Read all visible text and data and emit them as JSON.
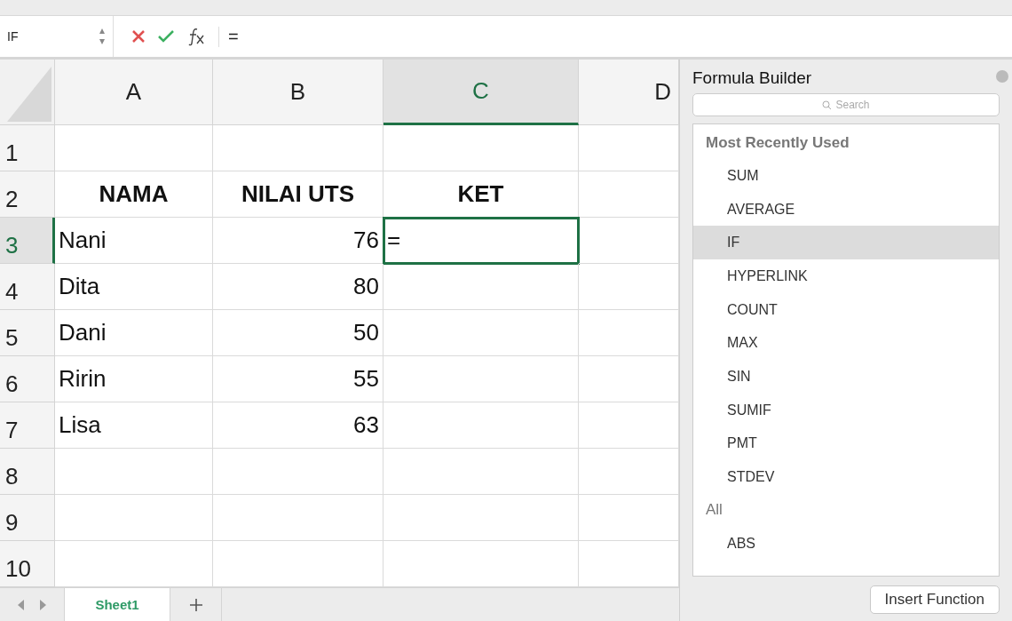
{
  "formula_bar": {
    "name_box": "IF",
    "formula": "="
  },
  "columns": [
    {
      "label": "A",
      "selected": false
    },
    {
      "label": "B",
      "selected": false
    },
    {
      "label": "C",
      "selected": true
    },
    {
      "label": "D",
      "selected": false
    }
  ],
  "rows": [
    {
      "label": "1",
      "selected": false,
      "cells": [
        {
          "text": "",
          "active": false
        },
        {
          "text": "",
          "active": false
        },
        {
          "text": "",
          "active": false
        },
        {
          "text": "",
          "active": false
        }
      ]
    },
    {
      "label": "2",
      "selected": false,
      "cells": [
        {
          "text": "NAMA",
          "active": false
        },
        {
          "text": "NILAI UTS",
          "active": false
        },
        {
          "text": "KET",
          "active": false
        },
        {
          "text": "",
          "active": false
        }
      ]
    },
    {
      "label": "3",
      "selected": true,
      "cells": [
        {
          "text": "Nani",
          "active": false
        },
        {
          "text": "76",
          "active": false
        },
        {
          "text": "=",
          "active": true
        },
        {
          "text": "",
          "active": false
        }
      ]
    },
    {
      "label": "4",
      "selected": false,
      "cells": [
        {
          "text": "Dita",
          "active": false
        },
        {
          "text": "80",
          "active": false
        },
        {
          "text": "",
          "active": false
        },
        {
          "text": "",
          "active": false
        }
      ]
    },
    {
      "label": "5",
      "selected": false,
      "cells": [
        {
          "text": "Dani",
          "active": false
        },
        {
          "text": "50",
          "active": false
        },
        {
          "text": "",
          "active": false
        },
        {
          "text": "",
          "active": false
        }
      ]
    },
    {
      "label": "6",
      "selected": false,
      "cells": [
        {
          "text": "Ririn",
          "active": false
        },
        {
          "text": "55",
          "active": false
        },
        {
          "text": "",
          "active": false
        },
        {
          "text": "",
          "active": false
        }
      ]
    },
    {
      "label": "7",
      "selected": false,
      "cells": [
        {
          "text": "Lisa",
          "active": false
        },
        {
          "text": "63",
          "active": false
        },
        {
          "text": "",
          "active": false
        },
        {
          "text": "",
          "active": false
        }
      ]
    },
    {
      "label": "8",
      "selected": false,
      "cells": [
        {
          "text": "",
          "active": false
        },
        {
          "text": "",
          "active": false
        },
        {
          "text": "",
          "active": false
        },
        {
          "text": "",
          "active": false
        }
      ]
    },
    {
      "label": "9",
      "selected": false,
      "cells": [
        {
          "text": "",
          "active": false
        },
        {
          "text": "",
          "active": false
        },
        {
          "text": "",
          "active": false
        },
        {
          "text": "",
          "active": false
        }
      ]
    },
    {
      "label": "10",
      "selected": false,
      "cells": [
        {
          "text": "",
          "active": false
        },
        {
          "text": "",
          "active": false
        },
        {
          "text": "",
          "active": false
        },
        {
          "text": "",
          "active": false
        }
      ]
    }
  ],
  "sheet_tabs": [
    {
      "label": "Sheet1",
      "selected": true
    }
  ],
  "formula_builder": {
    "title": "Formula Builder",
    "search": {
      "placeholder": "Search"
    },
    "groups": [
      {
        "label": "Most Recently Used",
        "children": [
          {
            "label": "SUM",
            "selected": false
          },
          {
            "label": "AVERAGE",
            "selected": false
          },
          {
            "label": "IF",
            "selected": true
          },
          {
            "label": "HYPERLINK",
            "selected": false
          },
          {
            "label": "COUNT",
            "selected": false
          },
          {
            "label": "MAX",
            "selected": false
          },
          {
            "label": "SIN",
            "selected": false
          },
          {
            "label": "SUMIF",
            "selected": false
          },
          {
            "label": "PMT",
            "selected": false
          },
          {
            "label": "STDEV",
            "selected": false
          }
        ]
      },
      {
        "label": "All",
        "children": [
          {
            "label": "ABS",
            "selected": false
          }
        ]
      }
    ],
    "button": "Insert Function"
  }
}
